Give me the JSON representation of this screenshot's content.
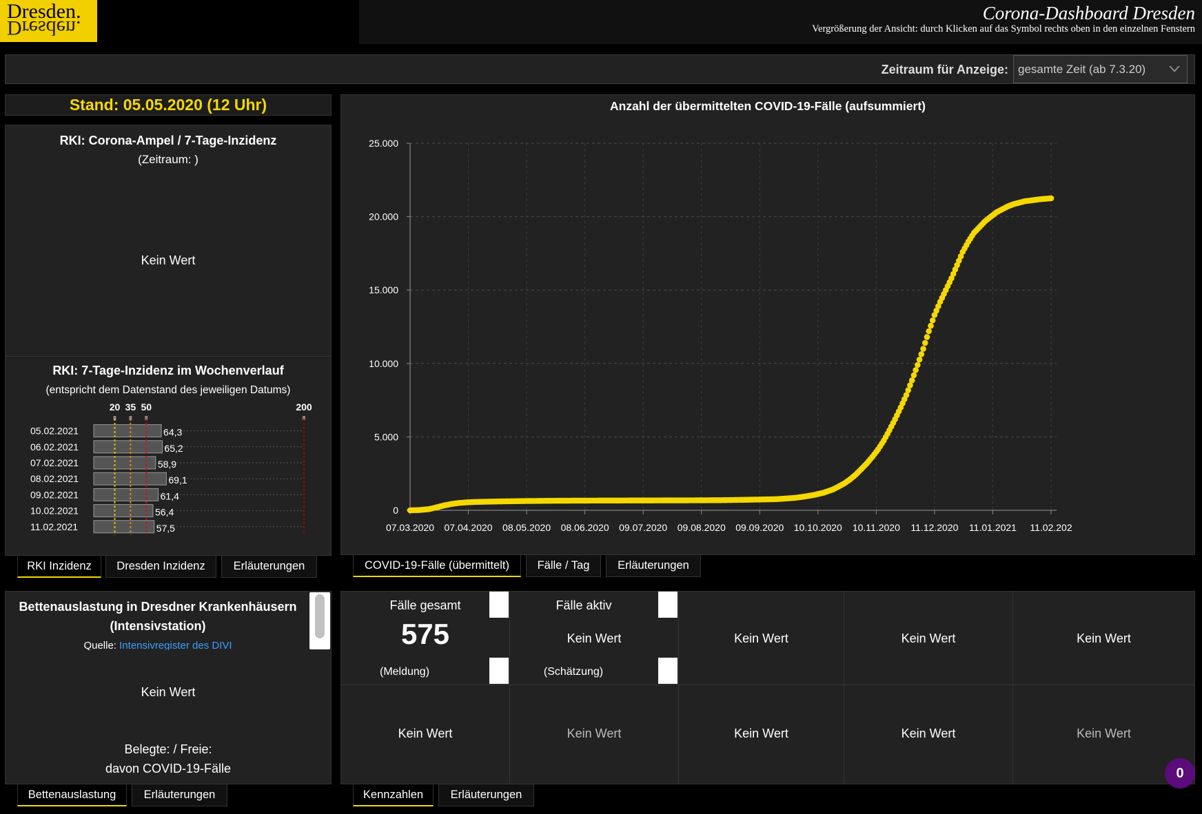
{
  "logo": {
    "text": "Dresden."
  },
  "header": {
    "title": "Corona-Dashboard Dresden",
    "subtitle": "Vergrößerung der Ansicht: durch Klicken auf das Symbol rechts oben in den einzelnen Fenstern"
  },
  "filter": {
    "label": "Zeitraum für Anzeige:",
    "value": "gesamte Zeit (ab 7.3.20)"
  },
  "stand": "Stand: 05.05.2020 (12 Uhr)",
  "ampel": {
    "title": "RKI: Corona-Ampel / 7-Tage-Inzidenz",
    "subtitle": "(Zeitraum: )",
    "value": "Kein Wert"
  },
  "weekly": {
    "title": "RKI: 7-Tage-Inzidenz im Wochenverlauf",
    "subtitle": "(entspricht dem Datenstand des jeweiligen Datums)",
    "thresholds": [
      {
        "label": "20",
        "value": 20,
        "color": "#e8b800"
      },
      {
        "label": "35",
        "value": 35,
        "color": "#e08800"
      },
      {
        "label": "50",
        "value": 50,
        "color": "#d01010"
      },
      {
        "label": "200",
        "value": 200,
        "color": "#a00000"
      }
    ],
    "rows": [
      {
        "date": "05.02.2021",
        "value": 64.3,
        "label": "64,3"
      },
      {
        "date": "06.02.2021",
        "value": 65.2,
        "label": "65,2"
      },
      {
        "date": "07.02.2021",
        "value": 58.9,
        "label": "58,9"
      },
      {
        "date": "08.02.2021",
        "value": 69.1,
        "label": "69,1"
      },
      {
        "date": "09.02.2021",
        "value": 61.4,
        "label": "61,4"
      },
      {
        "date": "10.02.2021",
        "value": 56.4,
        "label": "56,4"
      },
      {
        "date": "11.02.2021",
        "value": 57.5,
        "label": "57,5"
      }
    ]
  },
  "inzidenz_tabs": [
    "RKI Inzidenz",
    "Dresden Inzidenz",
    "Erläuterungen"
  ],
  "chart_tabs": [
    "COVID-19-Fälle (übermittelt)",
    "Fälle / Tag",
    "Erläuterungen"
  ],
  "chart_data": {
    "type": "scatter",
    "title": "Anzahl der übermittelten COVID-19-Fälle (aufsummiert)",
    "xlabel": "",
    "ylabel": "",
    "ylim": [
      0,
      25000
    ],
    "yticks": [
      0,
      5000,
      10000,
      15000,
      20000,
      25000
    ],
    "ytick_labels": [
      "0",
      "5.000",
      "10.000",
      "15.000",
      "20.000",
      "25.000"
    ],
    "x_tick_labels": [
      "07.03.2020",
      "07.04.2020",
      "08.05.2020",
      "08.06.2020",
      "09.07.2020",
      "09.08.2020",
      "09.09.2020",
      "10.10.2020",
      "10.11.2020",
      "11.12.2020",
      "11.01.2021",
      "11.02.202"
    ],
    "x_tick_days": [
      0,
      31,
      62,
      93,
      124,
      155,
      186,
      217,
      248,
      279,
      310,
      341
    ],
    "x_range_days": [
      0,
      341
    ],
    "color": "#f5d800",
    "series": [
      {
        "x": [
          0,
          5,
          10,
          14,
          18,
          22,
          26,
          30,
          35,
          45,
          60,
          75,
          90,
          105,
          120,
          135,
          150,
          165,
          180,
          195,
          205,
          210,
          215,
          220,
          225,
          228,
          231,
          234,
          237,
          240,
          243,
          246,
          249,
          252,
          255,
          258,
          261,
          264,
          267,
          270,
          273,
          276,
          279,
          282,
          285,
          288,
          291,
          294,
          297,
          300,
          303,
          306,
          309,
          312,
          315,
          318,
          321,
          324,
          327,
          330,
          333,
          336,
          339,
          341
        ],
        "y": [
          0,
          20,
          80,
          200,
          330,
          430,
          500,
          540,
          570,
          600,
          630,
          650,
          660,
          665,
          670,
          675,
          680,
          690,
          720,
          760,
          850,
          940,
          1050,
          1200,
          1420,
          1620,
          1830,
          2100,
          2420,
          2800,
          3200,
          3650,
          4150,
          4750,
          5450,
          6200,
          7000,
          7850,
          8850,
          9900,
          11000,
          12200,
          13300,
          14200,
          15000,
          15800,
          16700,
          17600,
          18300,
          18900,
          19300,
          19700,
          20000,
          20300,
          20500,
          20700,
          20850,
          20950,
          21050,
          21100,
          21150,
          21200,
          21230,
          21250
        ]
      }
    ]
  },
  "betten": {
    "title": "Bettenauslastung in Dresdner Krankenhäusern",
    "title2": "(Intensivstation)",
    "quelle": "Quelle:",
    "quelle_link": "Intensivregister des DIVI",
    "value": "Kein Wert",
    "line1": "Belegte: / Freie:",
    "line2": "davon COVID-19-Fälle"
  },
  "betten_tabs": [
    "Bettenauslastung",
    "Erläuterungen"
  ],
  "kennzahlen": {
    "faelle_gesamt": {
      "label": "Fälle gesamt",
      "value": "575",
      "sub": "(Meldung)"
    },
    "faelle_aktiv": {
      "label": "Fälle aktiv",
      "value": "Kein Wert",
      "sub": "(Schätzung)"
    },
    "top": [
      "Kein Wert",
      "Kein Wert",
      "Kein Wert"
    ],
    "bottom": [
      "Kein Wert",
      "Kein Wert",
      "Kein Wert",
      "Kein Wert",
      "Kein Wert"
    ]
  },
  "kennzahlen_tabs": [
    "Kennzahlen",
    "Erläuterungen"
  ],
  "badge": "0"
}
